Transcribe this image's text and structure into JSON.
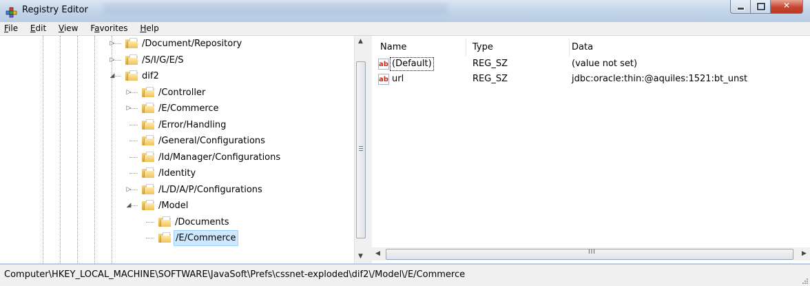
{
  "window": {
    "title": "Registry Editor",
    "accent": "#c7452f"
  },
  "menu": [
    {
      "key": "F",
      "rest": "ile"
    },
    {
      "key": "E",
      "rest": "dit"
    },
    {
      "key": "V",
      "rest": "iew"
    },
    {
      "pre": "F",
      "key": "a",
      "rest": "vorites"
    },
    {
      "key": "H",
      "rest": "elp"
    }
  ],
  "tree": {
    "nodes": [
      {
        "label": "/Document/Repository",
        "expander": "collapsed"
      },
      {
        "label": "/S/I/G/E/S",
        "expander": "collapsed"
      },
      {
        "label": "dif2",
        "expander": "expanded"
      },
      {
        "label": "/Controller",
        "expander": "collapsed"
      },
      {
        "label": "/E/Commerce",
        "expander": "collapsed"
      },
      {
        "label": "/Error/Handling",
        "expander": "none"
      },
      {
        "label": "/General/Configurations",
        "expander": "none"
      },
      {
        "label": "/Id/Manager/Configurations",
        "expander": "none"
      },
      {
        "label": "/Identity",
        "expander": "none"
      },
      {
        "label": "/L/D/A/P/Configurations",
        "expander": "collapsed"
      },
      {
        "label": "/Model",
        "expander": "expanded"
      },
      {
        "label": "/Documents",
        "expander": "none"
      },
      {
        "label": "/E/Commerce",
        "expander": "none",
        "selected": true
      }
    ]
  },
  "list": {
    "headers": {
      "name": "Name",
      "type": "Type",
      "data": "Data"
    },
    "rows": [
      {
        "icon": "string-value-icon",
        "icon_text": "ab",
        "name": "(Default)",
        "type": "REG_SZ",
        "data": "(value not set)"
      },
      {
        "icon": "string-value-icon",
        "icon_text": "ab",
        "name": "url",
        "type": "REG_SZ",
        "data": "jdbc:oracle:thin:@aquiles:1521:bt_unst"
      }
    ]
  },
  "hscroll": {
    "grip": "III"
  },
  "status": {
    "path": "Computer\\HKEY_LOCAL_MACHINE\\SOFTWARE\\JavaSoft\\Prefs\\cssnet-exploded\\dif2\\/Model\\/E/Commerce"
  }
}
